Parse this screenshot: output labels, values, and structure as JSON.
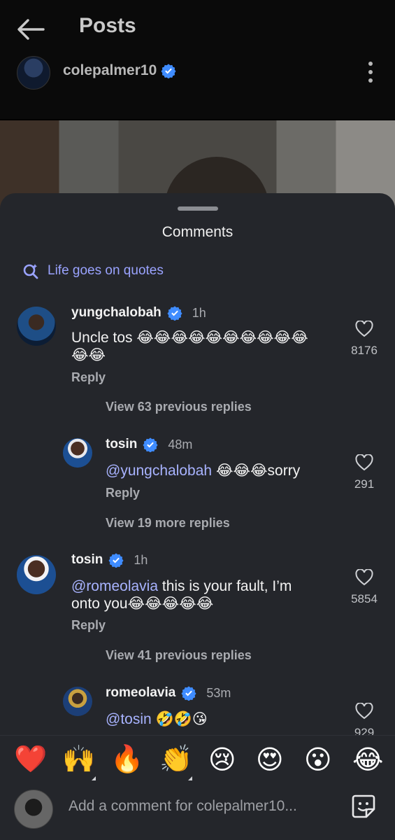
{
  "header": {
    "title": "Posts",
    "username": "colepalmer10"
  },
  "sheet": {
    "title": "Comments",
    "search_suggestion": "Life goes on quotes"
  },
  "comments": [
    {
      "user": "yungchalobah",
      "time": "1h",
      "text": "Uncle tos 😂😂😂😂😂😂😂😂😂😂",
      "text2": "😂😂",
      "reply": "Reply",
      "likes": "8176"
    },
    {
      "user": "tosin",
      "time": "48m",
      "mention": "@yungchalobah",
      "text": " 😂😂😂sorry",
      "reply": "Reply",
      "likes": "291"
    },
    {
      "user": "tosin",
      "time": "1h",
      "mention": "@romeolavia",
      "text": " this is your fault, I’m",
      "text2": "onto you😂😂😂😂😂",
      "reply": "Reply",
      "likes": "5854"
    },
    {
      "user": "romeolavia",
      "time": "53m",
      "mention": "@tosin",
      "text": " 🤣🤣😘",
      "likes": "929"
    }
  ],
  "view_replies": [
    "View 63 previous replies",
    "View 19 more replies",
    "View 41 previous replies"
  ],
  "emoji_bar": [
    "❤️",
    "🙌",
    "🔥",
    "👏",
    "😢",
    "😍",
    "😮",
    "😂"
  ],
  "input": {
    "placeholder": "Add a comment for colepalmer10..."
  },
  "colors": {
    "accent": "#a8b3ff",
    "verified": "#3f8cff",
    "sheet": "#24262b"
  }
}
